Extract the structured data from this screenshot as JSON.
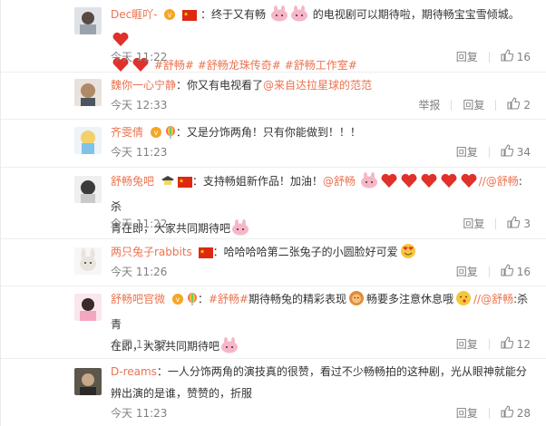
{
  "comments": [
    {
      "name": "Dec睚吖-",
      "text1": "：终于又有畅",
      "text2": "的电视剧可以期待啦，期待畅宝宝雪倾城。",
      "tags": "#舒畅# #舒畅龙珠传奇# #舒畅工作室#",
      "time": "今天 11:22",
      "reply": "回复",
      "likes": "16"
    },
    {
      "name": "魏你一心宁静",
      "text": "：你又有电视看了",
      "mention": "@来自达拉星球的范范",
      "time": "今天 12:33",
      "report": "举报",
      "reply": "回复",
      "likes": "2"
    },
    {
      "name": "齐雯倩",
      "text": "：又是分饰两角！只有你能做到！！！",
      "time": "今天 11:23",
      "reply": "回复",
      "likes": "34"
    },
    {
      "name": "舒畅兔吧",
      "text1": "：支持畅姐新作品！加油！",
      "mention1": "@舒畅",
      "mention2": "//@舒畅",
      "text2": ":杀",
      "text3": "青在即，大家共同期待吧",
      "time": "今天 11:22",
      "reply": "回复",
      "likes": "3"
    },
    {
      "name": "两只兔子rabbits",
      "text": "：哈哈哈哈第二张兔子的小圆脸好可爱",
      "time": "今天 11:26",
      "reply": "回复",
      "likes": "16"
    },
    {
      "name": "舒畅吧官微",
      "text0": "：",
      "tag": "#舒畅#",
      "text1": "期待畅兔的精彩表现",
      "text2": "畅要多注意休息哦",
      "mention": "//@舒畅",
      "text3": ":杀青",
      "text4": "在即，大家共同期待吧",
      "time": "今天 11:27",
      "reply": "回复",
      "likes": "12"
    },
    {
      "name": "D-reams",
      "text": "：一人分饰两角的演技真的很赞，看过不少畅畅拍的这种剧，光从眼神就能分辨出演的是谁，赞赞的，折服",
      "time": "今天 11:23",
      "reply": "回复",
      "likes": "28"
    }
  ],
  "colors": {
    "name": "#eb7350",
    "meta": "#808080",
    "text": "#333333"
  }
}
